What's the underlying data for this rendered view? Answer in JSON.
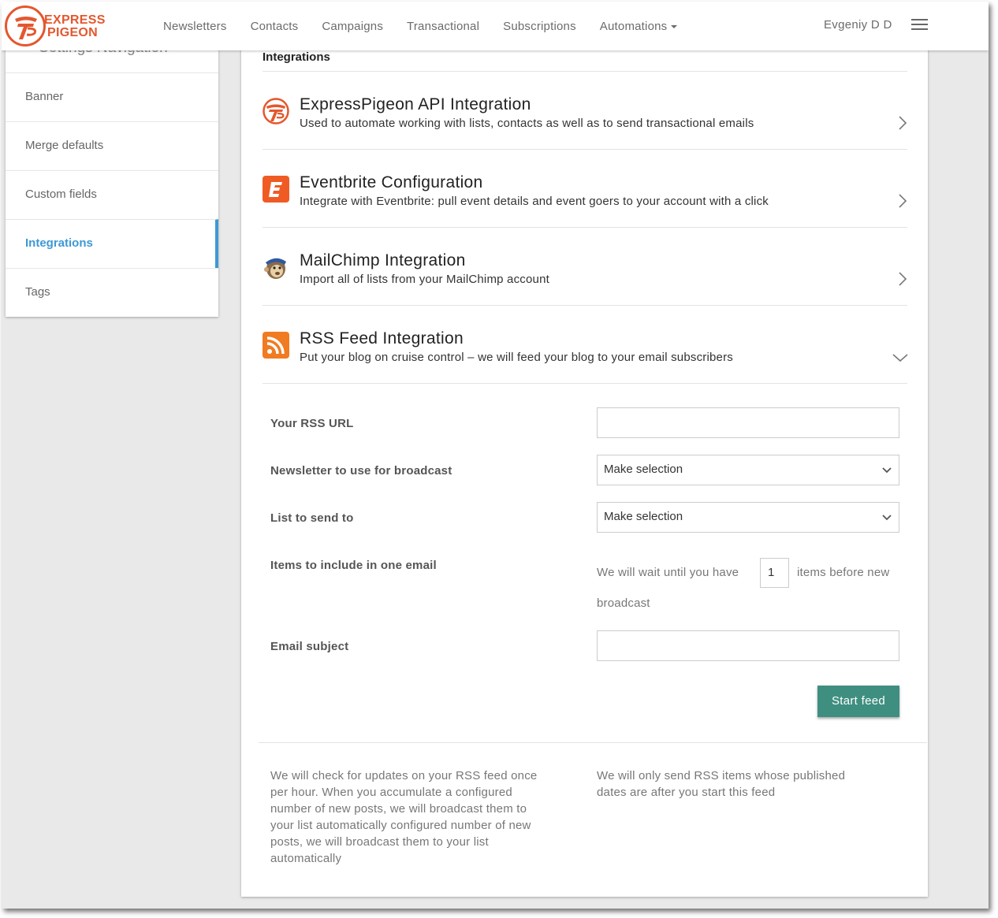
{
  "brand": {
    "name_line1": "EXPRESS",
    "name_line2": "PIGEON",
    "color": "#e4572e"
  },
  "nav": {
    "items": [
      "Newsletters",
      "Contacts",
      "Campaigns",
      "Transactional",
      "Subscriptions",
      "Automations"
    ],
    "user": "Evgeniy D D",
    "menu_icon": "hamburger-icon"
  },
  "sidebar": {
    "heading": "Settings Navigation",
    "items": [
      {
        "label": "Banner",
        "active": false
      },
      {
        "label": "Merge defaults",
        "active": false
      },
      {
        "label": "Custom fields",
        "active": false
      },
      {
        "label": "Integrations",
        "active": true
      },
      {
        "label": "Tags",
        "active": false
      }
    ],
    "active_color": "#3e98d4"
  },
  "main": {
    "title": "Integrations",
    "integrations": [
      {
        "icon": "expresspigeon-logo-icon",
        "title": "ExpressPigeon API Integration",
        "description": "Used to automate working with lists, contacts as well as to send transactional emails",
        "state": "collapsed"
      },
      {
        "icon": "eventbrite-icon",
        "title": "Eventbrite Configuration",
        "description": "Integrate with Eventbrite: pull event details and event goers to your account with a click",
        "state": "collapsed"
      },
      {
        "icon": "mailchimp-icon",
        "title": "MailChimp Integration",
        "description": "Import all of lists from your MailChimp account",
        "state": "collapsed"
      },
      {
        "icon": "rss-icon",
        "title": "RSS Feed Integration",
        "description": "Put your blog on cruise control – we will feed your blog to your email subscribers",
        "state": "expanded"
      }
    ],
    "rss_form": {
      "rss_url_label": "Your RSS URL",
      "rss_url_value": "",
      "newsletter_label": "Newsletter to use for broadcast",
      "newsletter_value": "Make selection",
      "list_label": "List to send to",
      "list_value": "Make selection",
      "items_label": "Items to include in one email",
      "items_prefix": "We will wait until you have",
      "items_value": "1",
      "items_suffix": "items before new",
      "items_suffix2": "broadcast",
      "subject_label": "Email subject",
      "subject_value": "",
      "start_button": "Start feed",
      "button_color": "#3f8f80"
    },
    "notes": {
      "left": [
        "We will check for updates on your RSS feed once",
        "per hour. When you accumulate a configured",
        "number of new posts, we will broadcast them to",
        "your list automatically configured number of new",
        "posts, we will broadcast them to your list",
        "automatically"
      ],
      "right": [
        "We will only send RSS items whose published",
        "dates are after you start this feed"
      ]
    }
  }
}
